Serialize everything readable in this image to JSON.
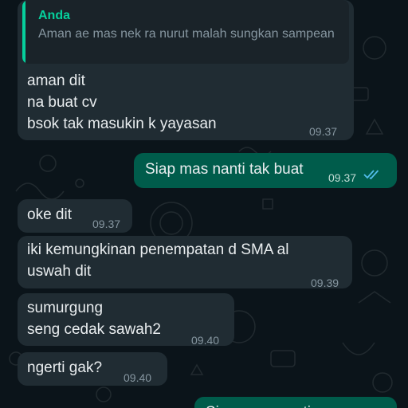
{
  "colors": {
    "background": "#0b141a",
    "incoming_bubble": "#202c33",
    "outgoing_bubble": "#005c4b",
    "quote_accent": "#06cf9c",
    "read_ticks": "#53bdeb"
  },
  "messages": [
    {
      "direction": "incoming",
      "quote": {
        "author": "Anda",
        "text": "Aman ae mas nek ra nurut malah sungkan sampean"
      },
      "lines": [
        "aman dit",
        "na buat cv",
        "bsok tak masukin k yayasan"
      ],
      "time": "09.37"
    },
    {
      "direction": "outgoing",
      "lines": [
        "Siap mas nanti tak buat"
      ],
      "time": "09.37",
      "status_icon": "double-check-read-icon"
    },
    {
      "direction": "incoming",
      "lines": [
        "oke dit"
      ],
      "time": "09.37"
    },
    {
      "direction": "incoming",
      "lines": [
        "iki kemungkinan penempatan d SMA al",
        "uswah dit"
      ],
      "time": "09.39"
    },
    {
      "direction": "incoming",
      "lines": [
        "sumurgung",
        "seng cedak sawah2"
      ],
      "time": "09.40"
    },
    {
      "direction": "incoming",
      "lines": [
        "ngerti gak?"
      ],
      "time": "09.40"
    },
    {
      "direction": "outgoing",
      "lines": [
        "Siap mas ngerti"
      ],
      "partially_visible": true
    }
  ]
}
